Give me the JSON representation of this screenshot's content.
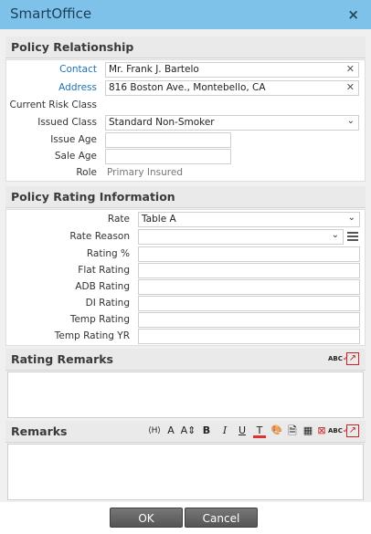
{
  "window": {
    "title": "SmartOffice",
    "close_glyph": "×"
  },
  "policy_relationship": {
    "header": "Policy Relationship",
    "contact": {
      "label": "Contact",
      "value": "Mr. Frank J. Bartelo"
    },
    "address": {
      "label": "Address",
      "value": "816 Boston Ave.,  Montebello, CA"
    },
    "current_risk_class": {
      "label": "Current Risk Class"
    },
    "issued_class": {
      "label": "Issued Class",
      "value": "Standard Non-Smoker"
    },
    "issue_age": {
      "label": "Issue Age",
      "value": ""
    },
    "sale_age": {
      "label": "Sale Age",
      "value": ""
    },
    "role": {
      "label": "Role",
      "value": "Primary Insured"
    }
  },
  "policy_rating": {
    "header": "Policy Rating Information",
    "rate": {
      "label": "Rate",
      "value": "Table A"
    },
    "rate_reason": {
      "label": "Rate Reason",
      "value": ""
    },
    "rating_pct": {
      "label": "Rating %",
      "value": ""
    },
    "flat_rating": {
      "label": "Flat Rating",
      "value": ""
    },
    "adb_rating": {
      "label": "ADB Rating",
      "value": ""
    },
    "di_rating": {
      "label": "DI Rating",
      "value": ""
    },
    "temp_rating": {
      "label": "Temp Rating",
      "value": ""
    },
    "temp_rating_yr": {
      "label": "Temp Rating YR",
      "value": ""
    }
  },
  "rating_remarks": {
    "header": "Rating Remarks",
    "value": ""
  },
  "remarks": {
    "header": "Remarks",
    "value": ""
  },
  "toolbar_glyphs": {
    "font": "⟨H⟩",
    "font_color": "A",
    "font_size": "A⇕",
    "bold": "B",
    "italic": "I",
    "underline": "U",
    "highlight": "T",
    "spellcheck": "ABC"
  },
  "footer": {
    "ok_label": "OK",
    "cancel_label": "Cancel"
  },
  "colors": {
    "titlebar": "#7ec2e9",
    "link": "#1a73b6",
    "button": "#666666",
    "spellcheck_red": "#cc2222"
  }
}
